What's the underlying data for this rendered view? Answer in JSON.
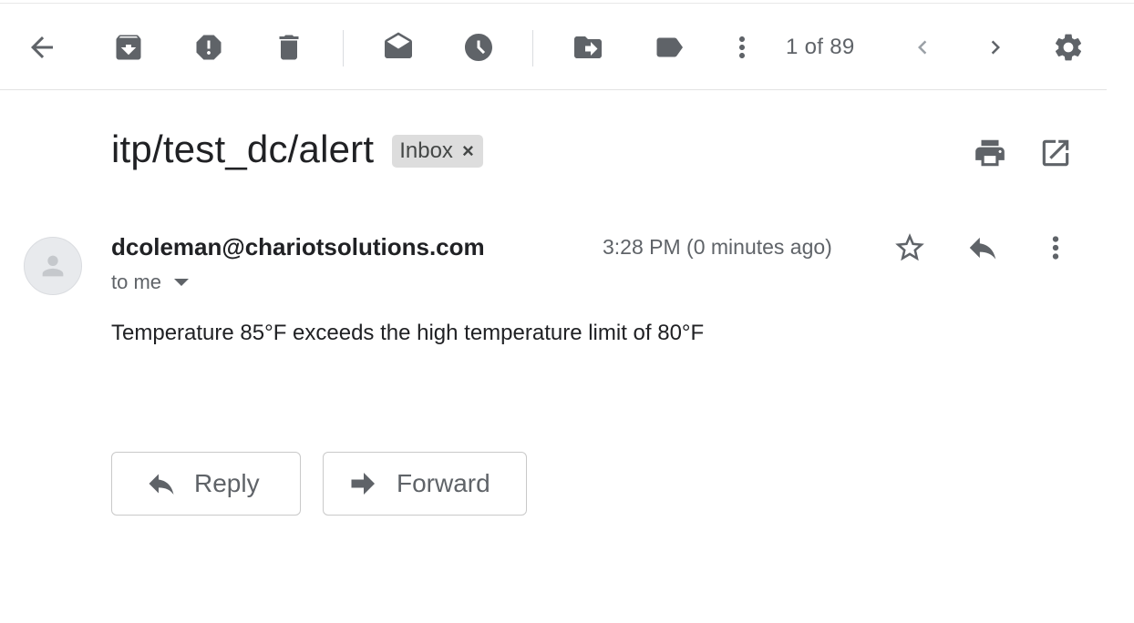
{
  "toolbar": {
    "page_count": "1 of 89",
    "icons": [
      "back-arrow-icon",
      "archive-icon",
      "report-spam-icon",
      "delete-icon",
      "mark-unread-icon",
      "snooze-icon",
      "move-to-icon",
      "labels-icon",
      "more-vert-icon",
      "chevron-left-icon",
      "chevron-right-icon",
      "gear-icon"
    ]
  },
  "message": {
    "subject": "itp/test_dc/alert",
    "label": "Inbox",
    "label_remove": "×",
    "sender": "dcoleman@chariotsolutions.com",
    "recipient": "to me",
    "time": "3:28 PM (0 minutes ago)",
    "body": "Temperature 85°F exceeds the high temperature limit of 80°F"
  },
  "actions": {
    "reply_label": "Reply",
    "forward_label": "Forward"
  },
  "colors": {
    "icon": "#5f6368",
    "text": "#202124",
    "chip_bg": "#dddddd",
    "border": "#c9c9c9"
  }
}
